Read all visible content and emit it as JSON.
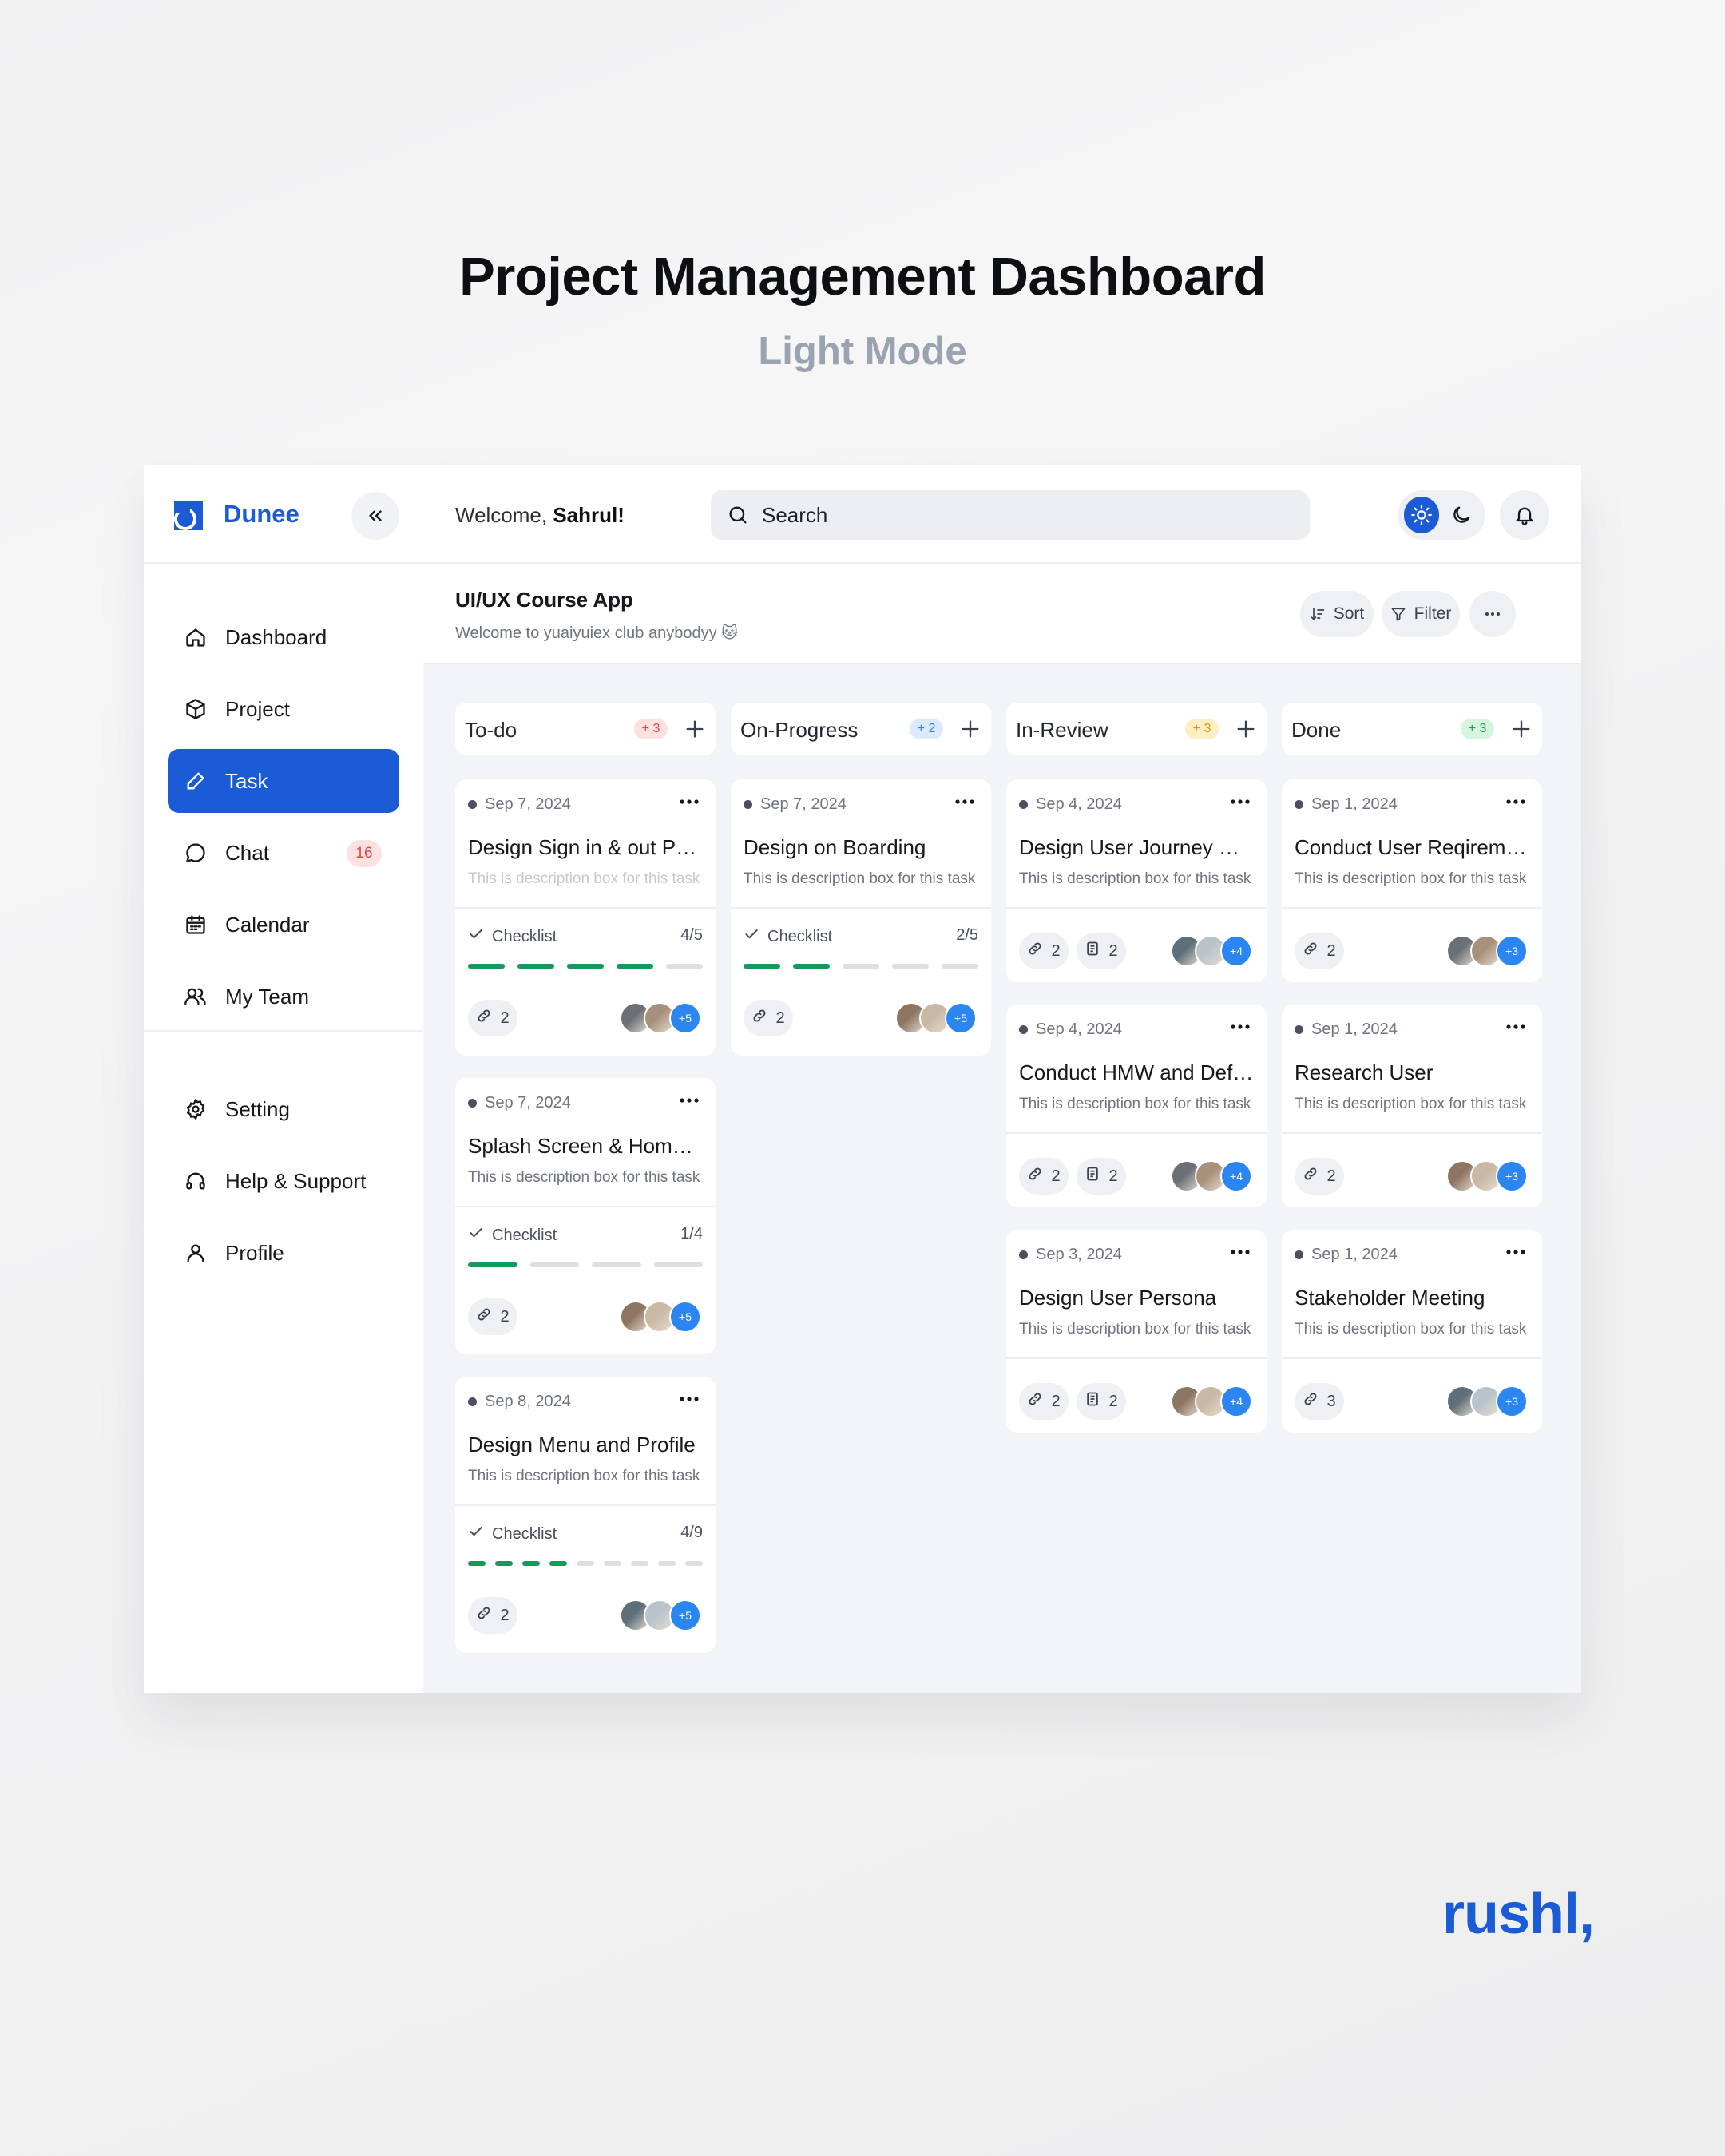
{
  "hero": {
    "title": "Project Management Dashboard",
    "subtitle": "Light Mode"
  },
  "brand": "rushl,",
  "app": {
    "logo_text": "Dunee",
    "welcome_prefix": "Welcome, ",
    "welcome_name": "Sahrul!",
    "search_label": "Search",
    "accent_color": "#1b5bd6"
  },
  "sidebar": {
    "items": [
      {
        "label": "Dashboard",
        "icon": "home-icon"
      },
      {
        "label": "Project",
        "icon": "cube-icon"
      },
      {
        "label": "Task",
        "icon": "pen-icon",
        "active": true
      },
      {
        "label": "Chat",
        "icon": "chat-icon",
        "badge": "16"
      },
      {
        "label": "Calendar",
        "icon": "calendar-icon"
      },
      {
        "label": "My Team",
        "icon": "team-icon"
      },
      {
        "label": "Setting",
        "icon": "gear-icon"
      },
      {
        "label": "Help & Support",
        "icon": "headset-icon"
      },
      {
        "label": "Profile",
        "icon": "user-icon"
      }
    ]
  },
  "project": {
    "title": "UI/UX Course App",
    "subtitle": "Welcome to yuaiyuiex club anybodyy 🐱",
    "sort_label": "Sort",
    "filter_label": "Filter"
  },
  "columns": [
    {
      "name": "To-do",
      "count": "+ 3",
      "count_color": "#e04848",
      "count_bg": "#fde1e1",
      "cards": [
        {
          "date": "Sep 7, 2024",
          "title": "Design Sign in & out Page",
          "desc": "This is description box for this task",
          "checklist_label": "Checklist",
          "checklist_count": "4/5",
          "done": 4,
          "total": 5,
          "links": "2",
          "more": "+5"
        },
        {
          "date": "Sep 7, 2024",
          "title": "Splash Screen & Home Page",
          "desc": "This is description box for this task",
          "checklist_label": "Checklist",
          "checklist_count": "1/4",
          "done": 1,
          "total": 4,
          "links": "2",
          "more": "+5"
        },
        {
          "date": "Sep 8, 2024",
          "title": "Design Menu and Profile",
          "desc": "This is description box for this task",
          "checklist_label": "Checklist",
          "checklist_count": "4/9",
          "done": 4,
          "total": 9,
          "links": "2",
          "more": "+5"
        }
      ]
    },
    {
      "name": "On-Progress",
      "count": "+ 2",
      "count_color": "#2c86f2",
      "count_bg": "#dbeafe",
      "cards": [
        {
          "date": "Sep 7, 2024",
          "title": "Design on Boarding",
          "desc": "This is description box for this task",
          "checklist_label": "Checklist",
          "checklist_count": "2/5",
          "done": 2,
          "total": 5,
          "links": "2",
          "more": "+5"
        }
      ]
    },
    {
      "name": "In-Review",
      "count": "+ 3",
      "count_color": "#d99a0b",
      "count_bg": "#fdefc4",
      "cards": [
        {
          "date": "Sep 4, 2024",
          "title": "Design User Journey Map",
          "desc": "This is description box for this task",
          "links": "2",
          "files": "2",
          "more": "+4"
        },
        {
          "date": "Sep 4, 2024",
          "title": "Conduct HMW and Define",
          "desc": "This is description box for this task",
          "links": "2",
          "files": "2",
          "more": "+4"
        },
        {
          "date": "Sep 3, 2024",
          "title": "Design User Persona",
          "desc": "This is description box for this task",
          "links": "2",
          "files": "2",
          "more": "+4"
        }
      ]
    },
    {
      "name": "Done",
      "count": "+ 3",
      "count_color": "#1f9d55",
      "count_bg": "#d6f5e0",
      "cards": [
        {
          "date": "Sep 1, 2024",
          "title": "Conduct User Reqirements",
          "desc": "This is description box for this task",
          "links": "2",
          "more": "+3"
        },
        {
          "date": "Sep 1, 2024",
          "title": "Research User",
          "desc": "This is description box for this task",
          "links": "2",
          "more": "+3"
        },
        {
          "date": "Sep 1, 2024",
          "title": "Stakeholder Meeting",
          "desc": "This is description box for this task",
          "links": "3",
          "more": "+3"
        }
      ]
    }
  ]
}
